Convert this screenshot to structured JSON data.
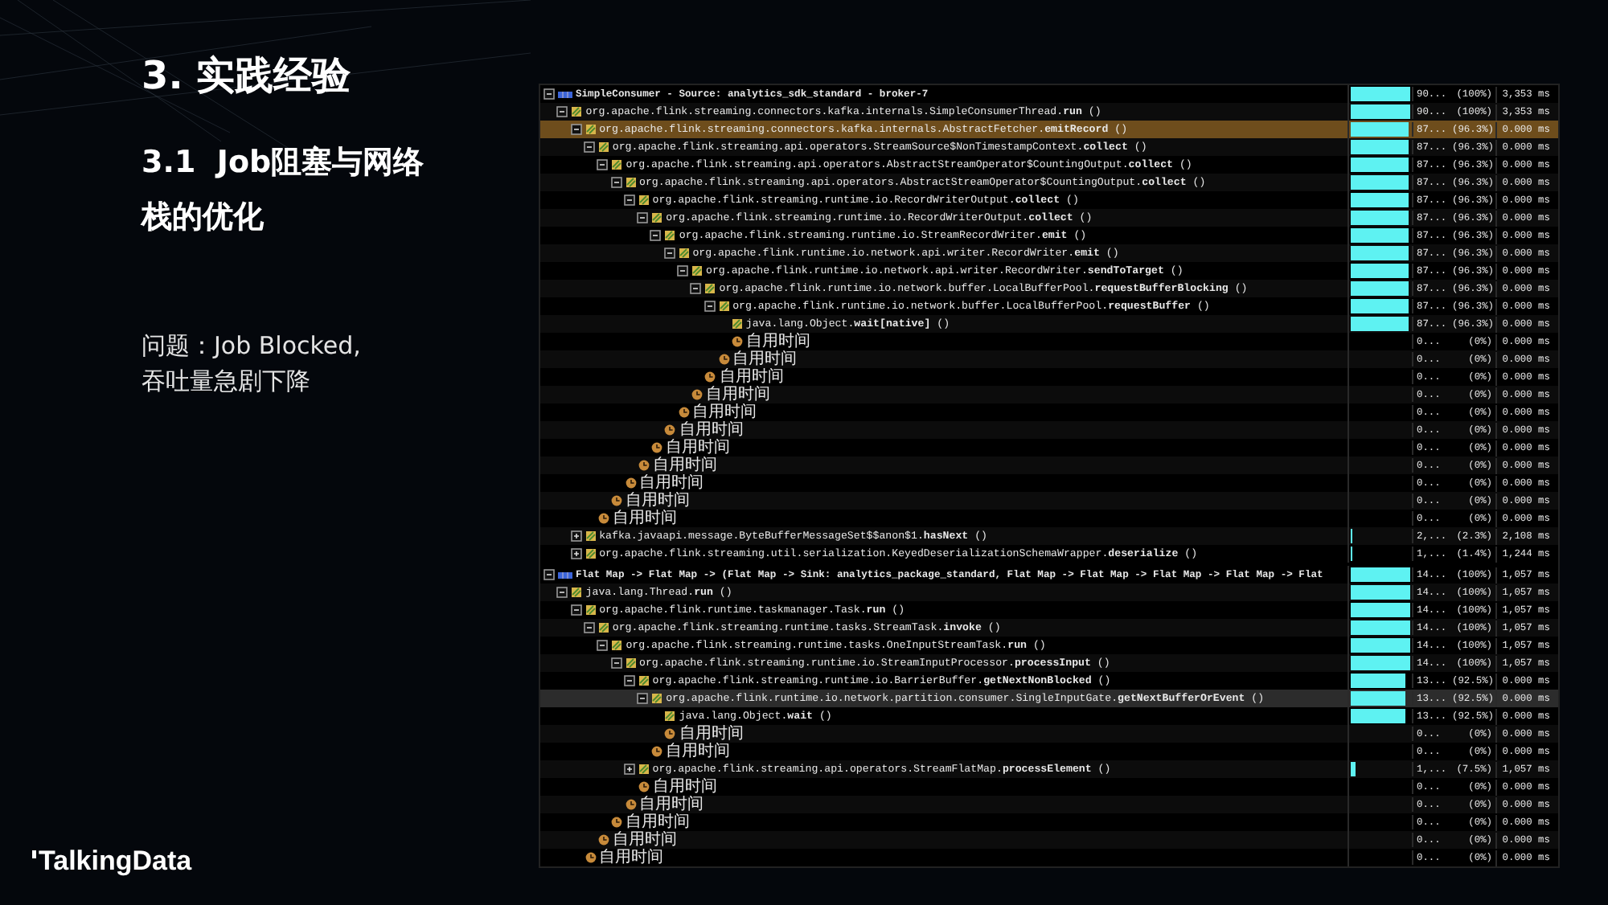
{
  "slide": {
    "title": "3. 实践经验",
    "subtitle": "3.1  Job阻塞与网络栈的优化",
    "body_lines": [
      "问题：Job Blocked,",
      "吞吐量急剧下降"
    ],
    "logo": "TalkingData"
  },
  "profiler": {
    "sections": [
      {
        "focused": true,
        "rows": [
          {
            "kind": "thread",
            "label": "SimpleConsumer - Source: analytics_sdk_standard - broker-7",
            "expanded": true,
            "selected": false,
            "level": 1,
            "count": "90...",
            "percent": "(100%)",
            "time": "3,353 ms",
            "children": [
              {
                "kind": "method",
                "label": "org.apache.flink.streaming.connectors.kafka.internals.SimpleConsumerThread.**run** ()",
                "expanded": true,
                "selected": false,
                "level": 1,
                "count": "90...",
                "percent": "(100%)",
                "time": "3,353 ms",
                "children": [
                  {
                    "kind": "method",
                    "label": "org.apache.flink.streaming.connectors.kafka.internals.AbstractFetcher.**emitRecord** ()",
                    "expanded": true,
                    "selected": true,
                    "level": 0.963,
                    "count": "87...",
                    "percent": "(96.3%)",
                    "time": "0.000 ms",
                    "children": [
                      {
                        "kind": "method",
                        "label": "org.apache.flink.streaming.api.operators.StreamSource$NonTimestampContext.**collect** ()",
                        "expanded": true,
                        "selected": false,
                        "level": 0.963,
                        "count": "87...",
                        "percent": "(96.3%)",
                        "time": "0.000 ms",
                        "children": [
                          {
                            "kind": "method",
                            "label": "org.apache.flink.streaming.api.operators.AbstractStreamOperator$CountingOutput.**collect** ()",
                            "expanded": true,
                            "selected": false,
                            "level": 0.963,
                            "count": "87...",
                            "percent": "(96.3%)",
                            "time": "0.000 ms",
                            "children": [
                              {
                                "kind": "method",
                                "label": "org.apache.flink.streaming.api.operators.AbstractStreamOperator$CountingOutput.**collect** ()",
                                "expanded": true,
                                "selected": false,
                                "level": 0.963,
                                "count": "87...",
                                "percent": "(96.3%)",
                                "time": "0.000 ms",
                                "children": [
                                  {
                                    "kind": "method",
                                    "label": "org.apache.flink.streaming.runtime.io.RecordWriterOutput.**collect** ()",
                                    "expanded": true,
                                    "selected": false,
                                    "level": 0.963,
                                    "count": "87...",
                                    "percent": "(96.3%)",
                                    "time": "0.000 ms",
                                    "children": [
                                      {
                                        "kind": "method",
                                        "label": "org.apache.flink.streaming.runtime.io.RecordWriterOutput.**collect** ()",
                                        "expanded": true,
                                        "selected": false,
                                        "level": 0.963,
                                        "count": "87...",
                                        "percent": "(96.3%)",
                                        "time": "0.000 ms",
                                        "children": [
                                          {
                                            "kind": "method",
                                            "label": "org.apache.flink.streaming.runtime.io.StreamRecordWriter.**emit** ()",
                                            "expanded": true,
                                            "selected": false,
                                            "level": 0.963,
                                            "count": "87...",
                                            "percent": "(96.3%)",
                                            "time": "0.000 ms",
                                            "children": [
                                              {
                                                "kind": "method",
                                                "label": "org.apache.flink.runtime.io.network.api.writer.RecordWriter.**emit** ()",
                                                "expanded": true,
                                                "selected": false,
                                                "level": 0.963,
                                                "count": "87...",
                                                "percent": "(96.3%)",
                                                "time": "0.000 ms",
                                                "children": [
                                                  {
                                                    "kind": "method",
                                                    "label": "org.apache.flink.runtime.io.network.api.writer.RecordWriter.**sendToTarget** ()",
                                                    "expanded": true,
                                                    "selected": false,
                                                    "level": 0.963,
                                                    "count": "87...",
                                                    "percent": "(96.3%)",
                                                    "time": "0.000 ms",
                                                    "children": [
                                                      {
                                                        "kind": "method",
                                                        "label": "org.apache.flink.runtime.io.network.buffer.LocalBufferPool.**requestBufferBlocking** ()",
                                                        "expanded": true,
                                                        "selected": false,
                                                        "level": 0.963,
                                                        "count": "87...",
                                                        "percent": "(96.3%)",
                                                        "time": "0.000 ms",
                                                        "children": [
                                                          {
                                                            "kind": "method",
                                                            "label": "org.apache.flink.runtime.io.network.buffer.LocalBufferPool.**requestBuffer** ()",
                                                            "expanded": true,
                                                            "selected": false,
                                                            "level": 0.963,
                                                            "count": "87...",
                                                            "percent": "(96.3%)",
                                                            "time": "0.000 ms",
                                                            "children": [
                                                              {
                                                                "kind": "method",
                                                                "label": "java.lang.Object.**wait[native]** ()",
                                                                "selected": false,
                                                                "level": 0.963,
                                                                "count": "87...",
                                                                "percent": "(96.3%)",
                                                                "time": "0.000 ms"
                                                              },
                                                              {
                                                                "kind": "self_time",
                                                                "label": "自用时间",
                                                                "selected": false,
                                                                "count": "0...",
                                                                "percent": "(0%)",
                                                                "time": "0.000 ms"
                                                              }
                                                            ]
                                                          },
                                                          {
                                                            "kind": "self_time",
                                                            "label": "自用时间",
                                                            "selected": false,
                                                            "count": "0...",
                                                            "percent": "(0%)",
                                                            "time": "0.000 ms"
                                                          }
                                                        ]
                                                      },
                                                      {
                                                        "kind": "self_time",
                                                        "label": "自用时间",
                                                        "selected": false,
                                                        "count": "0...",
                                                        "percent": "(0%)",
                                                        "time": "0.000 ms"
                                                      }
                                                    ]
                                                  },
                                                  {
                                                    "kind": "self_time",
                                                    "label": "自用时间",
                                                    "selected": false,
                                                    "count": "0...",
                                                    "percent": "(0%)",
                                                    "time": "0.000 ms"
                                                  }
                                                ]
                                              },
                                              {
                                                "kind": "self_time",
                                                "label": "自用时间",
                                                "selected": false,
                                                "count": "0...",
                                                "percent": "(0%)",
                                                "time": "0.000 ms"
                                              }
                                            ]
                                          },
                                          {
                                            "kind": "self_time",
                                            "label": "自用时间",
                                            "selected": false,
                                            "count": "0...",
                                            "percent": "(0%)",
                                            "time": "0.000 ms"
                                          }
                                        ]
                                      },
                                      {
                                        "kind": "self_time",
                                        "label": "自用时间",
                                        "selected": false,
                                        "count": "0...",
                                        "percent": "(0%)",
                                        "time": "0.000 ms"
                                      }
                                    ]
                                  },
                                  {
                                    "kind": "self_time",
                                    "label": "自用时间",
                                    "selected": false,
                                    "count": "0...",
                                    "percent": "(0%)",
                                    "time": "0.000 ms"
                                  }
                                ]
                              },
                              {
                                "kind": "self_time",
                                "label": "自用时间",
                                "selected": false,
                                "count": "0...",
                                "percent": "(0%)",
                                "time": "0.000 ms"
                              }
                            ]
                          },
                          {
                            "kind": "self_time",
                            "label": "自用时间",
                            "selected": false,
                            "count": "0...",
                            "percent": "(0%)",
                            "time": "0.000 ms"
                          }
                        ]
                      },
                      {
                        "kind": "self_time",
                        "label": "自用时间",
                        "selected": false,
                        "count": "0...",
                        "percent": "(0%)",
                        "time": "0.000 ms"
                      }
                    ]
                  },
                  {
                    "kind": "method",
                    "label": "kafka.javaapi.message.ByteBufferMessageSet$$anon$1.**hasNext** ()",
                    "expanded": false,
                    "selected": false,
                    "level": 0.023,
                    "count": "2,...",
                    "percent": "(2.3%)",
                    "time": "2,108 ms"
                  },
                  {
                    "kind": "method",
                    "label": "org.apache.flink.streaming.util.serialization.KeyedDeserializationSchemaWrapper.**deserialize** ()",
                    "expanded": false,
                    "selected": false,
                    "level": 0.014,
                    "count": "1,...",
                    "percent": "(1.4%)",
                    "time": "1,244 ms"
                  }
                ]
              }
            ]
          }
        ]
      },
      {
        "focused": false,
        "rows": [
          {
            "kind": "thread",
            "label": "Flat Map -> Flat Map -> (Flat Map -> Sink: analytics_package_standard, Flat Map -> Flat Map -> Flat Map -> Flat Map -> Flat",
            "expanded": true,
            "selected": false,
            "level": 1,
            "count": "14...",
            "percent": "(100%)",
            "time": "1,057 ms",
            "children": [
              {
                "kind": "method",
                "label": "java.lang.Thread.**run** ()",
                "expanded": true,
                "selected": false,
                "level": 1,
                "count": "14...",
                "percent": "(100%)",
                "time": "1,057 ms",
                "children": [
                  {
                    "kind": "method",
                    "label": "org.apache.flink.runtime.taskmanager.Task.**run** ()",
                    "expanded": true,
                    "selected": false,
                    "level": 1,
                    "count": "14...",
                    "percent": "(100%)",
                    "time": "1,057 ms",
                    "children": [
                      {
                        "kind": "method",
                        "label": "org.apache.flink.streaming.runtime.tasks.StreamTask.**invoke** ()",
                        "expanded": true,
                        "selected": false,
                        "level": 1,
                        "count": "14...",
                        "percent": "(100%)",
                        "time": "1,057 ms",
                        "children": [
                          {
                            "kind": "method",
                            "label": "org.apache.flink.streaming.runtime.tasks.OneInputStreamTask.**run** ()",
                            "expanded": true,
                            "selected": false,
                            "level": 1,
                            "count": "14...",
                            "percent": "(100%)",
                            "time": "1,057 ms",
                            "children": [
                              {
                                "kind": "method",
                                "label": "org.apache.flink.streaming.runtime.io.StreamInputProcessor.**processInput** ()",
                                "expanded": true,
                                "selected": false,
                                "level": 1,
                                "count": "14...",
                                "percent": "(100%)",
                                "time": "1,057 ms",
                                "children": [
                                  {
                                    "kind": "method",
                                    "label": "org.apache.flink.streaming.runtime.io.BarrierBuffer.**getNextNonBlocked** ()",
                                    "expanded": true,
                                    "selected": false,
                                    "level": 0.925,
                                    "count": "13...",
                                    "percent": "(92.5%)",
                                    "time": "0.000 ms",
                                    "children": [
                                      {
                                        "kind": "method",
                                        "label": "org.apache.flink.runtime.io.network.partition.consumer.SingleInputGate.**getNextBufferOrEvent** ()",
                                        "expanded": true,
                                        "selected": true,
                                        "level": 0.925,
                                        "count": "13...",
                                        "percent": "(92.5%)",
                                        "time": "0.000 ms",
                                        "children": [
                                          {
                                            "kind": "method",
                                            "label": "java.lang.Object.**wait** ()",
                                            "selected": false,
                                            "level": 0.925,
                                            "count": "13...",
                                            "percent": "(92.5%)",
                                            "time": "0.000 ms"
                                          },
                                          {
                                            "kind": "self_time",
                                            "label": "自用时间",
                                            "selected": false,
                                            "count": "0...",
                                            "percent": "(0%)",
                                            "time": "0.000 ms"
                                          }
                                        ]
                                      },
                                      {
                                        "kind": "self_time",
                                        "label": "自用时间",
                                        "selected": false,
                                        "count": "0...",
                                        "percent": "(0%)",
                                        "time": "0.000 ms"
                                      }
                                    ]
                                  },
                                  {
                                    "kind": "method",
                                    "label": "org.apache.flink.streaming.api.operators.StreamFlatMap.**processElement** ()",
                                    "expanded": false,
                                    "selected": false,
                                    "level": 0.075,
                                    "count": "1,...",
                                    "percent": "(7.5%)",
                                    "time": "1,057 ms"
                                  },
                                  {
                                    "kind": "self_time",
                                    "label": "自用时间",
                                    "selected": false,
                                    "count": "0...",
                                    "percent": "(0%)",
                                    "time": "0.000 ms"
                                  }
                                ]
                              },
                              {
                                "kind": "self_time",
                                "label": "自用时间",
                                "selected": false,
                                "count": "0...",
                                "percent": "(0%)",
                                "time": "0.000 ms"
                              }
                            ]
                          },
                          {
                            "kind": "self_time",
                            "label": "自用时间",
                            "selected": false,
                            "count": "0...",
                            "percent": "(0%)",
                            "time": "0.000 ms"
                          }
                        ]
                      },
                      {
                        "kind": "self_time",
                        "label": "自用时间",
                        "selected": false,
                        "count": "0...",
                        "percent": "(0%)",
                        "time": "0.000 ms"
                      }
                    ]
                  },
                  {
                    "kind": "self_time",
                    "label": "自用时间",
                    "selected": false,
                    "count": "0...",
                    "percent": "(0%)",
                    "time": "0.000 ms"
                  }
                ]
              }
            ]
          }
        ]
      }
    ]
  }
}
